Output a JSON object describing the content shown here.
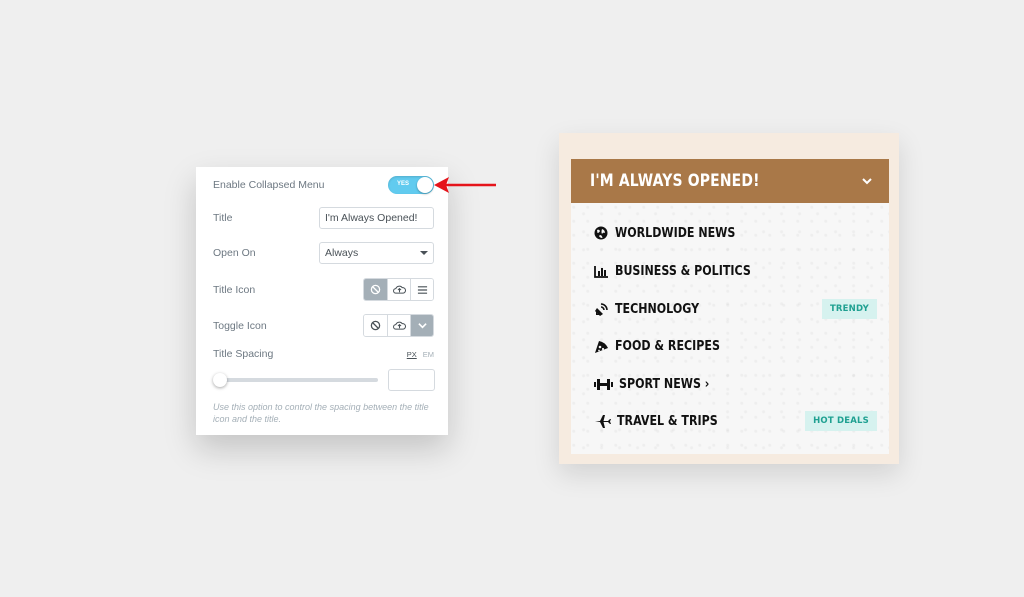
{
  "panel": {
    "enable_collapsed_label": "Enable Collapsed Menu",
    "toggle_text": "YES",
    "title_label": "Title",
    "title_value": "I'm Always Opened!",
    "open_on_label": "Open On",
    "open_on_value": "Always",
    "title_icon_label": "Title Icon",
    "toggle_icon_label": "Toggle Icon",
    "title_spacing_label": "Title Spacing",
    "unit_px": "PX",
    "unit_em": "EM",
    "help_text": "Use this option to control the spacing between the title icon and the title."
  },
  "menu": {
    "title": "I'M ALWAYS OPENED!",
    "items": [
      {
        "label": "WORLDWIDE NEWS",
        "icon": "globe-icon",
        "badge": ""
      },
      {
        "label": "BUSINESS & POLITICS",
        "icon": "bar-chart-icon",
        "badge": ""
      },
      {
        "label": "TECHNOLOGY",
        "icon": "satellite-icon",
        "badge": "TRENDY"
      },
      {
        "label": "FOOD & RECIPES",
        "icon": "pizza-icon",
        "badge": ""
      },
      {
        "label": "SPORT NEWS ›",
        "icon": "dumbbell-icon",
        "badge": ""
      },
      {
        "label": "TRAVEL & TRIPS",
        "icon": "plane-icon",
        "badge": "HOT DEALS"
      }
    ]
  },
  "colors": {
    "toggle_on": "#61cbef",
    "menu_header": "#a97848",
    "badge_bg": "#d6f2ef",
    "badge_text": "#1fa091",
    "arrow": "#e5141b"
  }
}
